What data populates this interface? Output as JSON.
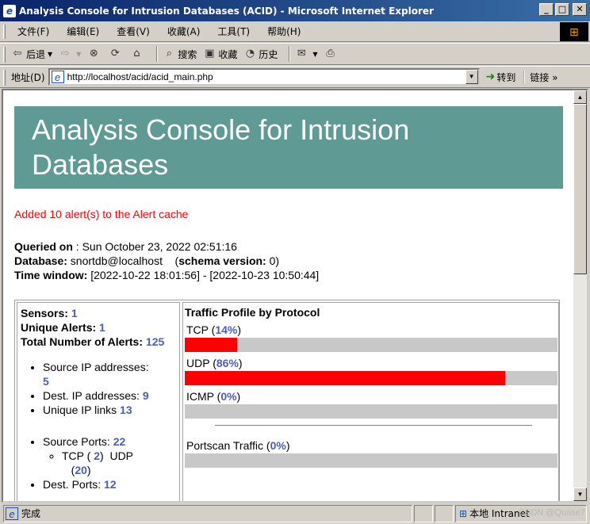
{
  "window": {
    "title": "Analysis Console for Intrusion Databases (ACID) - Microsoft Internet Explorer"
  },
  "menu": {
    "items": [
      "文件(F)",
      "编辑(E)",
      "查看(V)",
      "收藏(A)",
      "工具(T)",
      "帮助(H)"
    ]
  },
  "toolbar": {
    "back": "后退",
    "search": "搜索",
    "favorites": "收藏",
    "history": "历史"
  },
  "address": {
    "label": "地址(D)",
    "url": "http://localhost/acid/acid_main.php",
    "go": "转到",
    "links": "链接"
  },
  "page": {
    "heading": "Analysis Console for Intrusion Databases",
    "message": "Added 10 alert(s) to the Alert cache",
    "queried_label": "Queried on",
    "queried_value": " : Sun October 23, 2022 02:51:16",
    "database_label": "Database:",
    "database_value": " snortdb@localhost",
    "schema_label": "schema version:",
    "schema_value": " 0",
    "time_label": "Time window:",
    "time_value": " [2022-10-22 18:01:56] - [2022-10-23 10:50:44]"
  },
  "stats": {
    "sensors_label": "Sensors:",
    "sensors": "1",
    "unique_alerts_label": "Unique Alerts:",
    "unique_alerts": "1",
    "total_label": "Total Number of Alerts:",
    "total": "125",
    "src_ip_label": "Source IP addresses:",
    "src_ip": "5",
    "dst_ip_label": "Dest. IP addresses:",
    "dst_ip": "9",
    "ip_links_label": "Unique IP links",
    "ip_links": "13",
    "src_ports_label": "Source Ports:",
    "src_ports": "22",
    "tcp_label": "TCP",
    "tcp_ports": "2",
    "udp_label": "UDP",
    "udp_ports": "20",
    "dst_ports_label": "Dest. Ports:",
    "dst_ports": "12"
  },
  "traffic": {
    "title": "Traffic Profile by Protocol",
    "rows": [
      {
        "label": "TCP",
        "pct": "14%",
        "value": 14
      },
      {
        "label": "UDP",
        "pct": "86%",
        "value": 86
      },
      {
        "label": "ICMP",
        "pct": "0%",
        "value": 0
      }
    ],
    "portscan": {
      "label": "Portscan Traffic",
      "pct": "0%",
      "value": 0
    }
  },
  "status": {
    "text": "完成",
    "zone": "本地 Intranet",
    "watermark": "CSDN @Quase7"
  }
}
